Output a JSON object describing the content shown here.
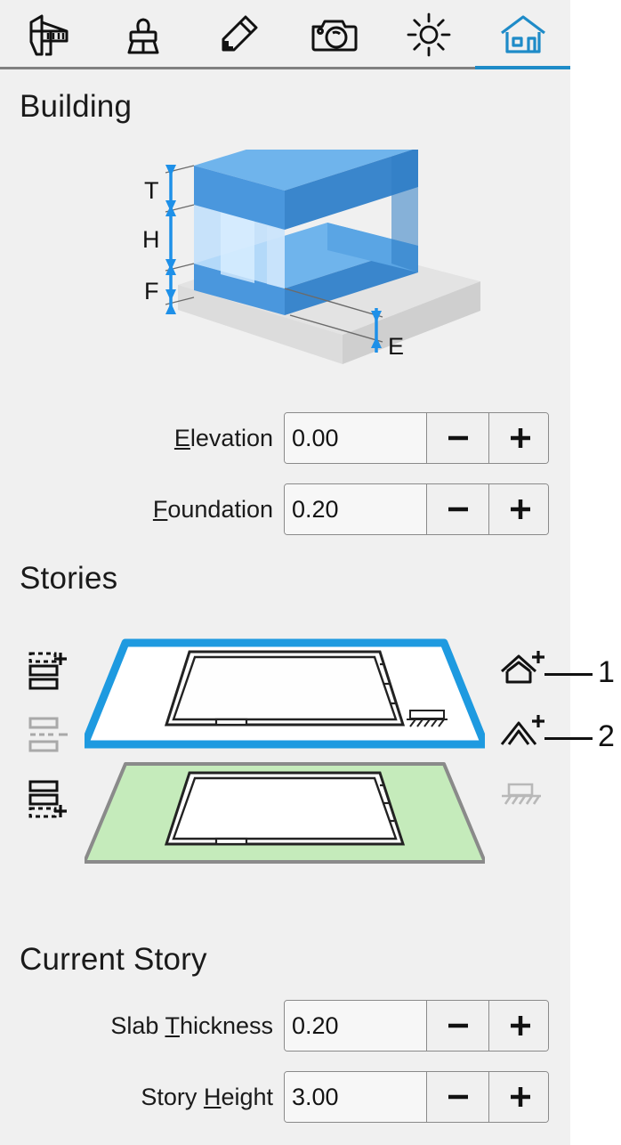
{
  "toolbar": {
    "tabs": [
      {
        "id": "measure",
        "icon": "caliper-icon",
        "label": "Measure",
        "active": false
      },
      {
        "id": "paint",
        "icon": "brush-icon",
        "label": "Paint",
        "active": false
      },
      {
        "id": "draw",
        "icon": "pencil-icon",
        "label": "Draw",
        "active": false
      },
      {
        "id": "camera",
        "icon": "camera-icon",
        "label": "Camera",
        "active": false
      },
      {
        "id": "sun",
        "icon": "sun-icon",
        "label": "Sun",
        "active": false
      },
      {
        "id": "building",
        "icon": "house-icon",
        "label": "Building",
        "active": true
      }
    ]
  },
  "colors": {
    "panel_bg": "#f0f0f0",
    "accent": "#1e8bc8",
    "roof_blue": "#4a97dd",
    "roof_blue_light": "#6fb4ec",
    "slab_gray": "#dcdcdc",
    "story_green": "#c5ebbb",
    "text": "#1a1a1a"
  },
  "building": {
    "heading": "Building",
    "diagram": {
      "labels": [
        "T",
        "H",
        "F",
        "E"
      ],
      "t_label": "T",
      "h_label": "H",
      "f_label": "F",
      "e_label": "E"
    },
    "elevation": {
      "label_pre": "",
      "label_accel": "E",
      "label_post": "levation",
      "value": "0.00",
      "minus": "—",
      "plus": "+"
    },
    "foundation": {
      "label_pre": "",
      "label_accel": "F",
      "label_post": "oundation",
      "value": "0.20",
      "minus": "—",
      "plus": "+"
    }
  },
  "stories": {
    "heading": "Stories",
    "left_tools": [
      {
        "id": "insert-above",
        "icon": "insert-story-above-icon",
        "enabled": true
      },
      {
        "id": "merge",
        "icon": "merge-stories-icon",
        "enabled": false
      },
      {
        "id": "insert-below",
        "icon": "insert-story-below-icon",
        "enabled": true
      }
    ],
    "right_tools": [
      {
        "id": "roof",
        "icon": "add-roof-icon",
        "enabled": true,
        "number": "1"
      },
      {
        "id": "gable",
        "icon": "add-gable-roof-icon",
        "enabled": true,
        "number": "2"
      },
      {
        "id": "foundation",
        "icon": "foundation-hatch-icon",
        "enabled": false,
        "number": ""
      }
    ],
    "plates": [
      {
        "id": "story-top",
        "selected": true,
        "fill": "#ffffff",
        "label": ""
      },
      {
        "id": "story-bottom",
        "selected": false,
        "fill": "#c5ebbb",
        "label": ""
      }
    ]
  },
  "current_story": {
    "heading": "Current Story",
    "slab_thickness": {
      "label_pre": "Slab ",
      "label_accel": "T",
      "label_post": "hickness",
      "value": "0.20",
      "minus": "—",
      "plus": "+"
    },
    "story_height": {
      "label_pre": "Story ",
      "label_accel": "H",
      "label_post": "eight",
      "value": "3.00",
      "minus": "—",
      "plus": "+"
    }
  }
}
